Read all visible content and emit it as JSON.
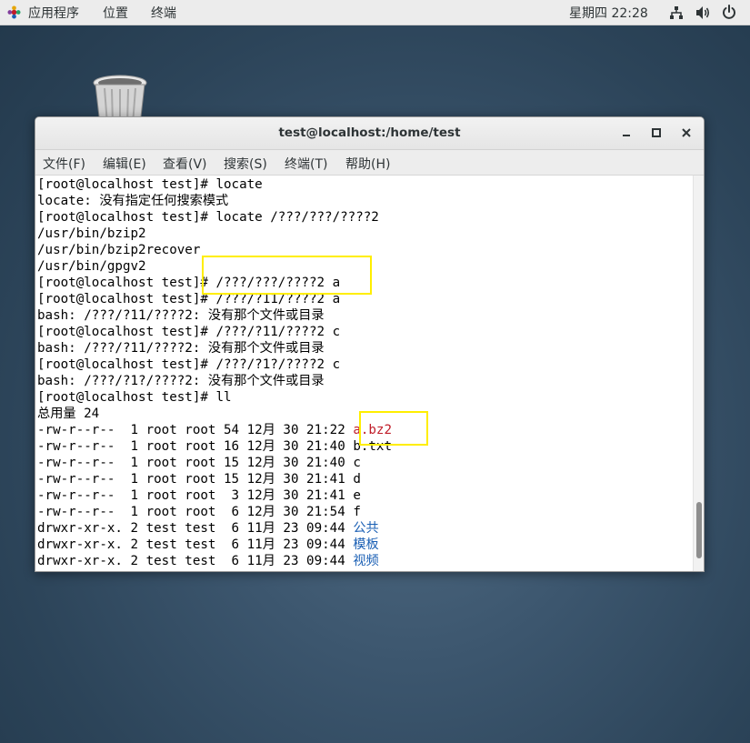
{
  "topbar": {
    "apps_label": "应用程序",
    "places_label": "位置",
    "terminal_label": "终端",
    "clock": "星期四 22:28",
    "icons": [
      "apps-icon",
      "network-icon",
      "volume-icon",
      "power-icon"
    ]
  },
  "desktop": {
    "trash_icon": "trash-icon"
  },
  "window": {
    "title": "test@localhost:/home/test",
    "controls": [
      "minimize-icon",
      "maximize-icon",
      "close-icon"
    ],
    "menu": {
      "file": "文件(F)",
      "edit": "编辑(E)",
      "view": "查看(V)",
      "search": "搜索(S)",
      "terminal": "终端(T)",
      "help": "帮助(H)"
    }
  },
  "terminal": {
    "lines": [
      {
        "text": "[root@localhost test]# locate"
      },
      {
        "text": "locate: 没有指定任何搜索模式"
      },
      {
        "text": "[root@localhost test]# locate /???/???/????2"
      },
      {
        "text": "/usr/bin/bzip2"
      },
      {
        "text": "/usr/bin/bzip2recover"
      },
      {
        "text": "/usr/bin/gpgv2"
      },
      {
        "text": "[root@localhost test]# /???/???/????2 a"
      },
      {
        "text": "[root@localhost test]# /???/?11/????2 a"
      },
      {
        "text": "bash: /???/?11/????2: 没有那个文件或目录"
      },
      {
        "text": "[root@localhost test]# /???/?11/????2 c"
      },
      {
        "text": "bash: /???/?11/????2: 没有那个文件或目录"
      },
      {
        "text": "[root@localhost test]# /???/?1?/????2 c"
      },
      {
        "text": "bash: /???/?1?/????2: 没有那个文件或目录"
      },
      {
        "text": "[root@localhost test]# ll"
      },
      {
        "text": "总用量 24"
      },
      {
        "prefix": "-rw-r--r--  1 root root 54 12月 30 21:22 ",
        "name": "a.bz2",
        "color": "red"
      },
      {
        "prefix": "-rw-r--r--  1 root root 16 12月 30 21:40 ",
        "name": "b.txt"
      },
      {
        "prefix": "-rw-r--r--  1 root root 15 12月 30 21:40 ",
        "name": "c"
      },
      {
        "prefix": "-rw-r--r--  1 root root 15 12月 30 21:41 ",
        "name": "d"
      },
      {
        "prefix": "-rw-r--r--  1 root root  3 12月 30 21:41 ",
        "name": "e"
      },
      {
        "prefix": "-rw-r--r--  1 root root  6 12月 30 21:54 ",
        "name": "f"
      },
      {
        "prefix": "drwxr-xr-x. 2 test test  6 11月 23 09:44 ",
        "name": "公共",
        "color": "blue"
      },
      {
        "prefix": "drwxr-xr-x. 2 test test  6 11月 23 09:44 ",
        "name": "模板",
        "color": "blue"
      },
      {
        "prefix": "drwxr-xr-x. 2 test test  6 11月 23 09:44 ",
        "name": "视频",
        "color": "blue"
      }
    ]
  },
  "colors": {
    "archive": "#c01c28",
    "directory": "#1a5fb4",
    "highlight": "#ffee00"
  }
}
